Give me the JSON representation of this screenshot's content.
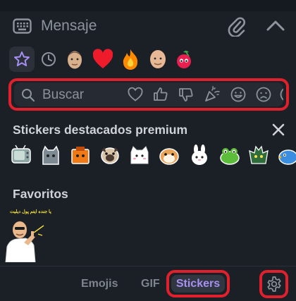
{
  "colors": {
    "background": "#1b1f26",
    "panel": "#262b33",
    "accent": "#a88ff3",
    "highlight": "#e1202d",
    "icon": "#8e949c"
  },
  "message_bar": {
    "placeholder": "Mensaje",
    "icons": [
      "keyboard-icon",
      "attach-icon",
      "chevron-up-icon"
    ]
  },
  "quick_row": {
    "icons": [
      "star-icon",
      "clock-icon"
    ],
    "emojis": [
      "man-face-emoji",
      "red-heart-emoji",
      "fire-emoji",
      "bald-man-emoji",
      "cherries-emoji"
    ]
  },
  "search": {
    "placeholder": "Buscar",
    "categories": [
      "heart-icon",
      "thumbs-up-icon",
      "thumbs-down-icon",
      "party-popper-icon",
      "smile-icon",
      "sad-icon",
      "angry-icon"
    ]
  },
  "premium": {
    "title": "Stickers destacados premium",
    "close_label": "✕",
    "stickers": [
      "tv-sticker",
      "cat-ghost-sticker",
      "box-sticker",
      "pug-sticker",
      "cat-sticker",
      "hamster-sticker",
      "bunny-sticker",
      "frog-sticker",
      "bat-sticker",
      "bird-sticker"
    ]
  },
  "favorites": {
    "title": "Favoritos",
    "sticker_caption": "يا جنده ايتم پول ديليت"
  },
  "tabs": {
    "emojis": "Emojis",
    "gif": "GIF",
    "stickers": "Stickers"
  }
}
